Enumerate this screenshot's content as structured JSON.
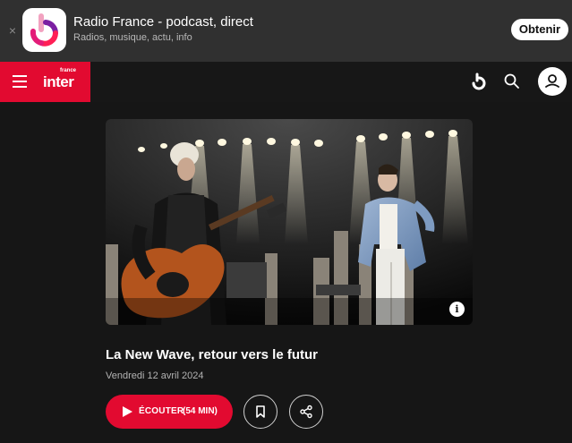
{
  "app_banner": {
    "close_symbol": "×",
    "title": "Radio France - podcast, direct",
    "subtitle": "Radios, musique, actu, info",
    "get_label": "Obtenir",
    "icon": "radio-france-app-icon"
  },
  "header": {
    "logo_main": "inter",
    "logo_small": "france",
    "icons": [
      "menu-icon",
      "radio-france-icon",
      "search-icon",
      "user-icon"
    ],
    "accent_color": "#e20a30"
  },
  "episode": {
    "image_alt": "concert-photo",
    "info_symbol": "i",
    "title": "La New Wave, retour vers le futur",
    "date": "Vendredi 12 avril 2024",
    "listen_label": "ÉCOUTER",
    "listen_duration": "(54 MIN)"
  },
  "actions": {
    "icons": [
      "play-icon",
      "bookmark-icon",
      "share-icon"
    ]
  }
}
